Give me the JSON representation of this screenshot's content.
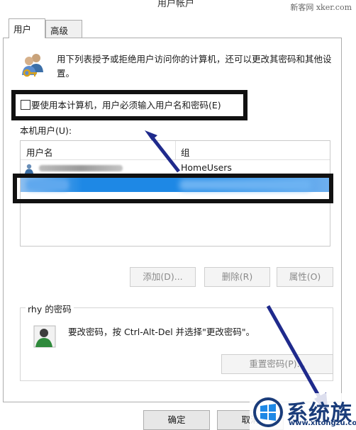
{
  "window": {
    "title": "用户帐户"
  },
  "watermark_top": "新客网 xker.com",
  "tabs": [
    {
      "label": "用户",
      "active": true
    },
    {
      "label": "高级",
      "active": false
    }
  ],
  "intro": {
    "text": "用下列表授予或拒绝用户访问你的计算机，还可以更改其密码和其他设置。",
    "icon": "users-key-icon"
  },
  "require_login": {
    "label": "要使用本计算机，用户必须输入用户名和密码(E)",
    "checked": false
  },
  "users_section": {
    "label": "本机用户(U):",
    "columns": [
      "用户名",
      "组"
    ],
    "rows": [
      {
        "name": "",
        "group": "HomeUsers",
        "selected": false
      },
      {
        "name": "",
        "group": "",
        "selected": true
      }
    ]
  },
  "buttons": {
    "add": "添加(D)...",
    "remove": "删除(R)",
    "properties": "属性(O)",
    "reset_password": "重置密码(P)...",
    "ok": "确定",
    "cancel": "取消"
  },
  "password_group": {
    "title": "rhy 的密码",
    "text": "要改密码，按 Ctrl-Alt-Del 并选择\"更改密码\"。"
  },
  "brand": {
    "name": "系统族",
    "url": "www.xitongzu.com"
  },
  "colors": {
    "selection": "#1e88e5",
    "annotation_arrow": "#1f2a8c",
    "annotation_box": "#111111",
    "brand": "#1a3c7a"
  }
}
